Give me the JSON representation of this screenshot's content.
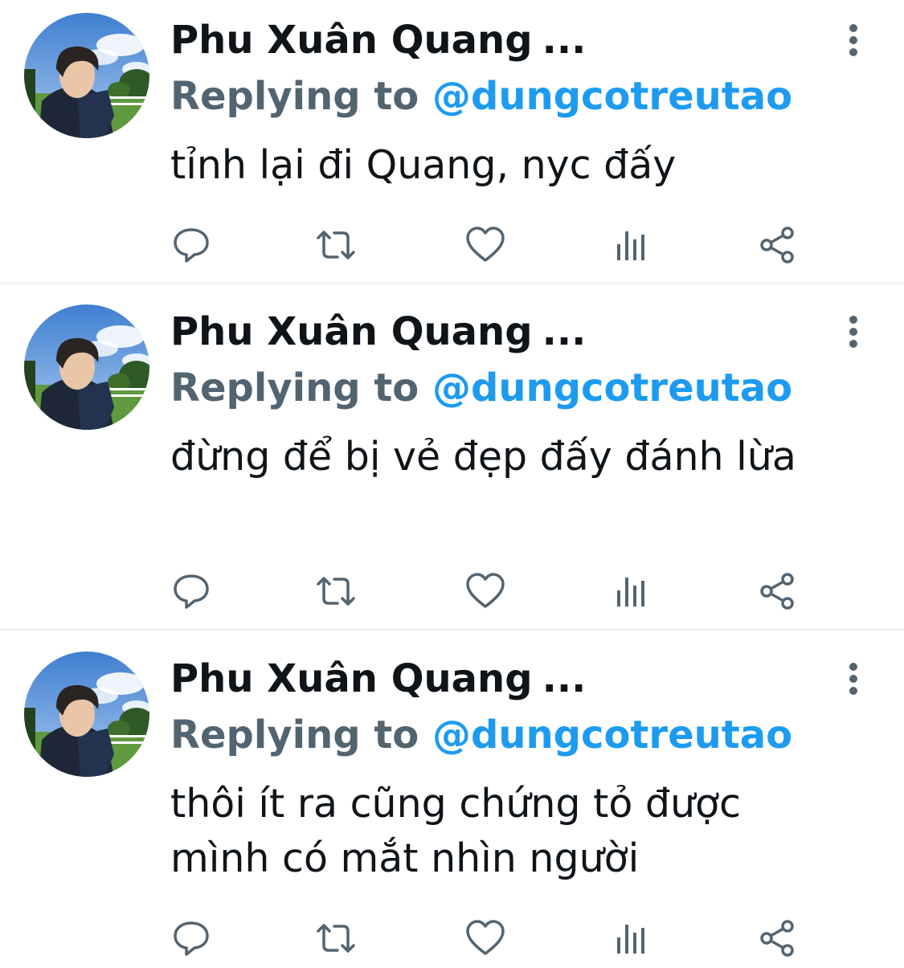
{
  "colors": {
    "name": "#0f1419",
    "secondary": "#536471",
    "link": "#1d9bf0",
    "icon": "#536471",
    "divider": "#eff3f4"
  },
  "tweets": [
    {
      "author": "Phu Xuân Quang",
      "ellipsis": "...",
      "replying_prefix": "Replying to",
      "reply_handle": "@dungcotreutao",
      "text": "tỉnh lại đi Quang, nyc đấy",
      "actions": [
        "reply-icon",
        "retweet-icon",
        "like-icon",
        "analytics-icon",
        "share-icon"
      ]
    },
    {
      "author": "Phu Xuân Quang",
      "ellipsis": "...",
      "replying_prefix": "Replying to",
      "reply_handle": "@dungcotreutao",
      "text": "đừng để bị vẻ đẹp đấy đánh lừa",
      "actions": [
        "reply-icon",
        "retweet-icon",
        "like-icon",
        "analytics-icon",
        "share-icon"
      ]
    },
    {
      "author": "Phu Xuân Quang",
      "ellipsis": "...",
      "replying_prefix": "Replying to",
      "reply_handle": "@dungcotreutao",
      "text": "thôi ít ra cũng chứng tỏ được mình có mắt nhìn người",
      "actions": [
        "reply-icon",
        "retweet-icon",
        "like-icon",
        "analytics-icon",
        "share-icon"
      ]
    }
  ]
}
